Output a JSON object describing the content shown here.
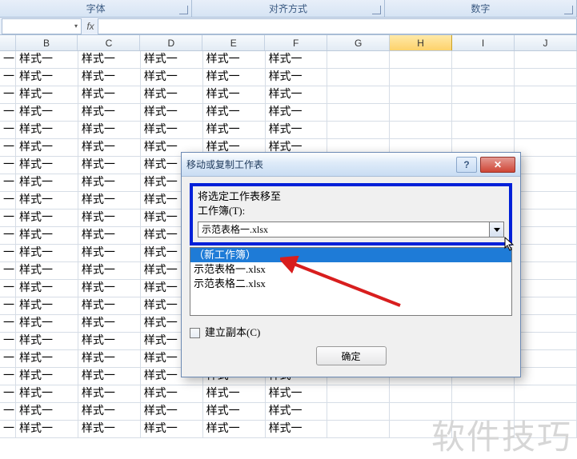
{
  "ribbon": {
    "groups": [
      "字体",
      "对齐方式",
      "数字"
    ]
  },
  "formula_bar": {
    "name_box": "",
    "fx": "fx"
  },
  "columns": [
    "B",
    "C",
    "D",
    "E",
    "F",
    "G",
    "H",
    "I",
    "J"
  ],
  "selected_column": "H",
  "sample_text": "样式一",
  "dash": "一",
  "rows_count": 22,
  "data_cols": [
    "B",
    "C",
    "D",
    "E",
    "F"
  ],
  "dialog": {
    "title": "移动或复制工作表",
    "label_moveto": "将选定工作表移至",
    "label_workbook": "工作簿(T):",
    "combo_value": "示范表格一.xlsx",
    "list_items": [
      {
        "label": "（新工作簿）",
        "selected": true
      },
      {
        "label": "示范表格一.xlsx",
        "selected": false
      },
      {
        "label": "示范表格二.xlsx",
        "selected": false
      }
    ],
    "checkbox_label": "建立副本(C)",
    "ok_label": "确定",
    "help_symbol": "?",
    "close_symbol": "✕"
  },
  "watermark": "软件技巧"
}
